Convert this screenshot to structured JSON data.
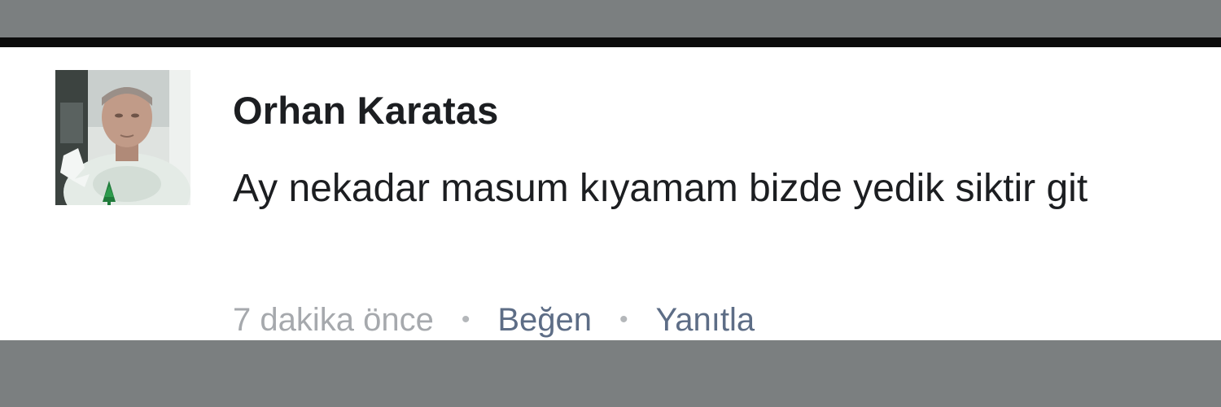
{
  "comment": {
    "author": "Orhan Karatas",
    "text": "Ay nekadar masum kıyamam bizde yedik siktir git",
    "timestamp": "7 dakika önce",
    "separator": "•",
    "actions": {
      "like_label": "Beğen",
      "reply_label": "Yanıtla"
    }
  },
  "colors": {
    "band_gray": "#7b7f80",
    "black_bar": "#0c0c0c",
    "card_bg": "#ffffff",
    "text_primary": "#1c1e21",
    "text_muted": "#a6a9ad",
    "action_link": "#5d6d86"
  }
}
